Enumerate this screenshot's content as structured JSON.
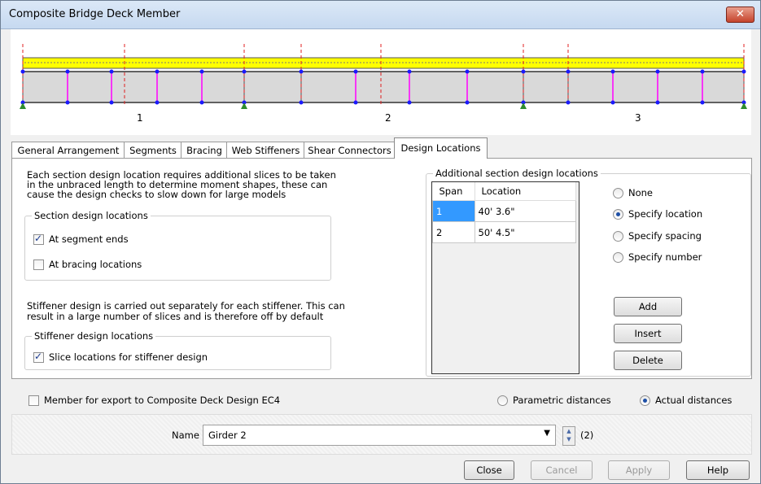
{
  "window": {
    "title": "Composite Bridge Deck Member",
    "close_glyph": "✕"
  },
  "diagram": {
    "span_labels": [
      "1",
      "2",
      "3"
    ]
  },
  "tabs": [
    "General Arrangement",
    "Segments",
    "Bracing",
    "Web Stiffeners",
    "Shear Connectors",
    "Design Locations"
  ],
  "active_tab": "Design Locations",
  "design_locations": {
    "intro_line1": "Each section design location requires additional slices to be taken",
    "intro_line2": "in the unbraced length to determine moment shapes, these can",
    "intro_line3": "cause the design checks to slow down for large models",
    "section_group_title": "Section design locations",
    "at_segment_ends": {
      "label": "At segment ends",
      "checked": true
    },
    "at_bracing_locations": {
      "label": "At bracing locations",
      "checked": false
    },
    "stiffener_line1": "Stiffener design is carried out separately for each stiffener. This can",
    "stiffener_line2": "result in a large number of slices and is therefore off by default",
    "stiffener_group_title": "Stiffener design locations",
    "slice_locations": {
      "label": "Slice locations for stiffener design",
      "checked": true
    },
    "additional_group_title": "Additional section design locations",
    "table": {
      "headers": [
        "Span",
        "Location"
      ],
      "rows": [
        [
          "1",
          "40' 3.6\""
        ],
        [
          "2",
          "50' 4.5\""
        ]
      ]
    },
    "radio_none": "None",
    "radio_specify_location": "Specify location",
    "radio_specify_spacing": "Specify spacing",
    "radio_specify_number": "Specify number",
    "selected_radio": "Specify location",
    "add_label": "Add",
    "insert_label": "Insert",
    "delete_label": "Delete"
  },
  "footer": {
    "export_label": "Member for export to Composite Deck Design EC4",
    "export_checked": false,
    "parametric_label": "Parametric distances",
    "actual_label": "Actual distances",
    "selected_distance": "Actual distances"
  },
  "name_row": {
    "label": "Name",
    "value": "Girder 2",
    "count": "(2)"
  },
  "buttons": {
    "close": "Close",
    "cancel": "Cancel",
    "apply": "Apply",
    "help": "Help"
  }
}
